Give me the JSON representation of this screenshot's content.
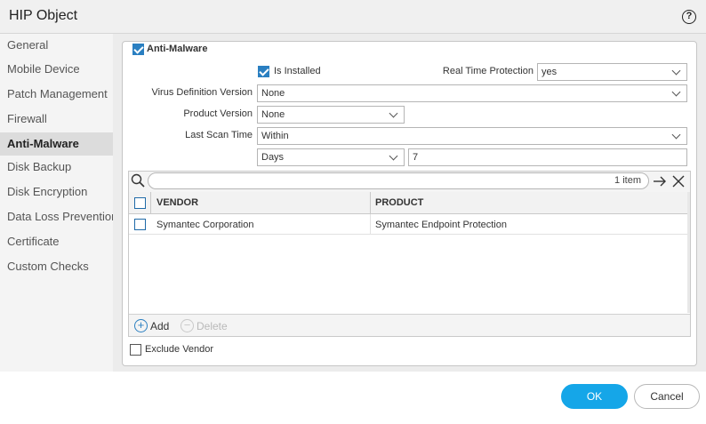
{
  "dialog": {
    "title": "HIP Object"
  },
  "sidebar": {
    "items": [
      {
        "label": "General"
      },
      {
        "label": "Mobile Device"
      },
      {
        "label": "Patch Management"
      },
      {
        "label": "Firewall"
      },
      {
        "label": "Anti-Malware"
      },
      {
        "label": "Disk Backup"
      },
      {
        "label": "Disk Encryption"
      },
      {
        "label": "Data Loss Prevention"
      },
      {
        "label": "Certificate"
      },
      {
        "label": "Custom Checks"
      }
    ],
    "active": "Anti-Malware"
  },
  "section": {
    "legend": "Anti-Malware",
    "enabled": true,
    "is_installed_label": "Is Installed",
    "is_installed_checked": true,
    "rtp_label": "Real Time Protection",
    "rtp_value": "yes",
    "vdv_label": "Virus Definition Version",
    "vdv_value": "None",
    "pv_label": "Product Version",
    "pv_value": "None",
    "lst_label": "Last Scan Time",
    "lst_value": "Within",
    "unit_value": "Days",
    "amount_value": "7"
  },
  "grid": {
    "count": "1 item",
    "columns": [
      "VENDOR",
      "PRODUCT"
    ],
    "rows": [
      {
        "vendor": "Symantec Corporation",
        "product": "Symantec Endpoint Protection"
      }
    ],
    "add_label": "Add",
    "delete_label": "Delete"
  },
  "exclude_vendor_label": "Exclude Vendor",
  "buttons": {
    "ok": "OK",
    "cancel": "Cancel"
  },
  "colors": {
    "accent": "#15a6e8",
    "checkbox": "#2a7fc1",
    "active_nav": "#dcdcdc"
  }
}
